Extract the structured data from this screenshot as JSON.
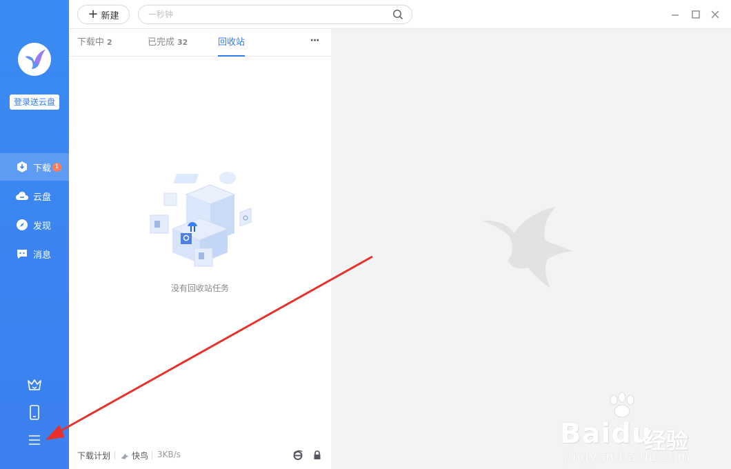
{
  "sidebar": {
    "login_label": "登录送云盘",
    "nav": [
      {
        "label": "下载",
        "icon": "download-icon",
        "badge": "1",
        "active": true
      },
      {
        "label": "云盘",
        "icon": "cloud-icon"
      },
      {
        "label": "发现",
        "icon": "compass-icon"
      },
      {
        "label": "消息",
        "icon": "message-icon"
      }
    ],
    "bottom_icons": [
      "crown-icon",
      "phone-icon",
      "menu-icon"
    ]
  },
  "toolbar": {
    "new_label": "新建",
    "search_placeholder": "一秒钟"
  },
  "tabs": [
    {
      "label": "下载中",
      "count": "2"
    },
    {
      "label": "已完成",
      "count": "32"
    },
    {
      "label": "回收站",
      "count": "",
      "active": true
    }
  ],
  "empty_state": {
    "text": "没有回收站任务"
  },
  "footer": {
    "plan_label": "下载计划",
    "bird_label": "快鸟",
    "speed": "3KB/s"
  },
  "watermark": {
    "logo": "Baidu",
    "cn": "经验",
    "url": "jingyan.baidu.com"
  },
  "colors": {
    "accent": "#2f7bf0",
    "sidebar": "#3a8bf2",
    "badge": "#ff7c5c",
    "annotation_arrow": "#e8312a"
  }
}
